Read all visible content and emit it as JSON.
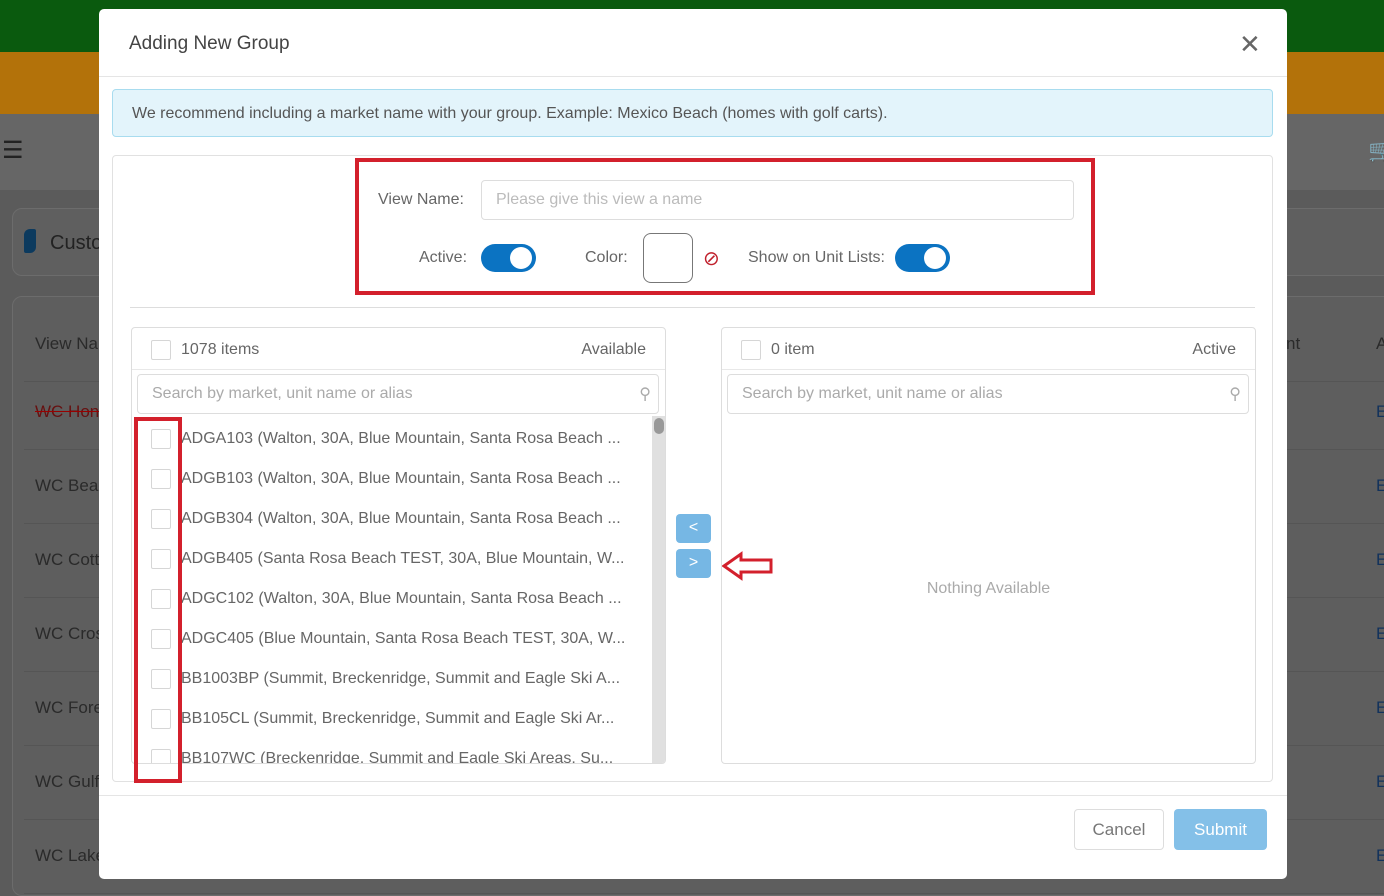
{
  "background": {
    "card_title": "Custo",
    "table_header": "View Na",
    "header_right": "nt",
    "header_action": "A",
    "rows": [
      "WC Hon",
      "WC Beac",
      "WC Cott",
      "WC Cros",
      "WC Fore",
      "WC Gulf",
      "WC Lake"
    ],
    "row_action": "E"
  },
  "modal": {
    "title": "Adding New Group",
    "alert": "We recommend including a market name with your group. Example: Mexico Beach (homes with golf carts).",
    "view_name_label": "View Name:",
    "view_name_value": "",
    "view_name_placeholder": "Please give this view a name",
    "active_label": "Active:",
    "active": true,
    "color_label": "Color:",
    "show_label": "Show on Unit Lists:",
    "show_on_unit_lists": true,
    "available": {
      "count": "1078 items",
      "title": "Available",
      "search_placeholder": "Search by market, unit name or alias",
      "items": [
        "ADGA103 (Walton, 30A, Blue Mountain, Santa Rosa Beach ...",
        "ADGB103 (Walton, 30A, Blue Mountain, Santa Rosa Beach ...",
        "ADGB304 (Walton, 30A, Blue Mountain, Santa Rosa Beach ...",
        "ADGB405 (Santa Rosa Beach TEST, 30A, Blue Mountain, W...",
        "ADGC102 (Walton, 30A, Blue Mountain, Santa Rosa Beach ...",
        "ADGC405 (Blue Mountain, Santa Rosa Beach TEST, 30A, W...",
        "BB1003BP (Summit, Breckenridge, Summit and Eagle Ski A...",
        "BB105CL (Summit, Breckenridge, Summit and Eagle Ski Ar...",
        "BB107WC (Breckenridge, Summit and Eagle Ski Areas, Su..."
      ]
    },
    "active_list": {
      "count": "0 item",
      "title": "Active",
      "search_placeholder": "Search by market, unit name or alias",
      "empty": "Nothing Available"
    },
    "move_left": "<",
    "move_right": ">",
    "cancel": "Cancel",
    "submit": "Submit"
  },
  "colors": {
    "accent": "#0b73c2",
    "annotation": "#d3202c",
    "submit": "#84c0e8"
  }
}
